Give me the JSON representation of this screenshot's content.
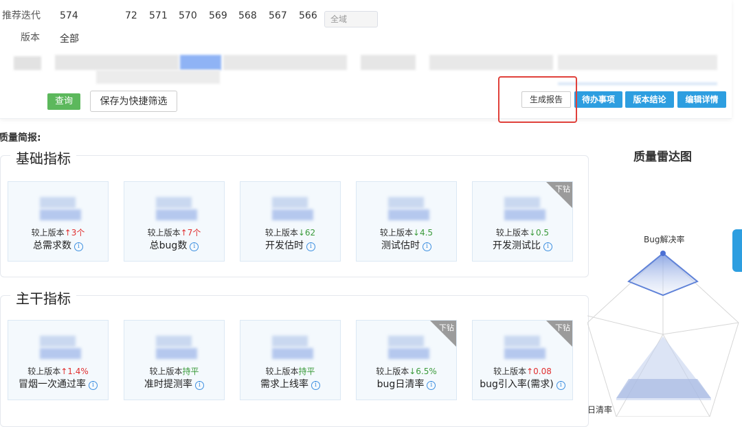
{
  "filters": {
    "iteration_label": "推荐迭代",
    "iterations": [
      "574",
      "72",
      "571",
      "570",
      "569",
      "568",
      "567",
      "566"
    ],
    "scope_placeholder": "全域",
    "version_label": "版本",
    "version_value": "全部"
  },
  "actions": {
    "query": "查询",
    "save_filter": "保存为快捷筛选",
    "generate_report": "生成报告",
    "todo": "待办事项",
    "conclusion": "版本结论",
    "edit_details": "编辑详情"
  },
  "quality_brief_label": "质量简报:",
  "basic_section": {
    "title": "基础指标",
    "cards": [
      {
        "compare_label": "较上版本",
        "arrow": "↑",
        "delta": "3个",
        "trend": "up",
        "name": "总需求数",
        "drill": ""
      },
      {
        "compare_label": "较上版本",
        "arrow": "↑",
        "delta": "7个",
        "trend": "up",
        "name": "总bug数",
        "drill": ""
      },
      {
        "compare_label": "较上版本",
        "arrow": "↓",
        "delta": "62",
        "trend": "down",
        "name": "开发估时",
        "drill": ""
      },
      {
        "compare_label": "较上版本",
        "arrow": "↓",
        "delta": "4.5",
        "trend": "down",
        "name": "测试估时",
        "drill": ""
      },
      {
        "compare_label": "较上版本",
        "arrow": "↓",
        "delta": "0.5",
        "trend": "down",
        "name": "开发测试比",
        "drill": "下钻"
      }
    ]
  },
  "main_section": {
    "title": "主干指标",
    "cards": [
      {
        "compare_label": "较上版本",
        "arrow": "↑",
        "delta": "1.4%",
        "trend": "up",
        "name": "冒烟一次通过率",
        "drill": ""
      },
      {
        "compare_label": "较上版本",
        "arrow": "",
        "delta": "持平",
        "trend": "flat",
        "name": "准时提测率",
        "drill": ""
      },
      {
        "compare_label": "较上版本",
        "arrow": "",
        "delta": "持平",
        "trend": "flat",
        "name": "需求上线率",
        "drill": ""
      },
      {
        "compare_label": "较上版本",
        "arrow": "↓",
        "delta": "6.5%",
        "trend": "down",
        "name": "bug日清率",
        "drill": "下钻"
      },
      {
        "compare_label": "较上版本",
        "arrow": "↑",
        "delta": "0.08",
        "trend": "up",
        "name": "bug引入率(需求)",
        "drill": "下钻"
      }
    ]
  },
  "info_glyph": "i",
  "radar": {
    "title": "质量雷达图",
    "axis_top": "Bug解决率",
    "axis_bottom_left": "日清率"
  },
  "colors": {
    "primary_blue": "#2d9ee0",
    "query_green": "#5cb85c",
    "highlight_red": "#e0403a",
    "up_red": "#e02f2f",
    "down_green": "#3a9a3a"
  }
}
